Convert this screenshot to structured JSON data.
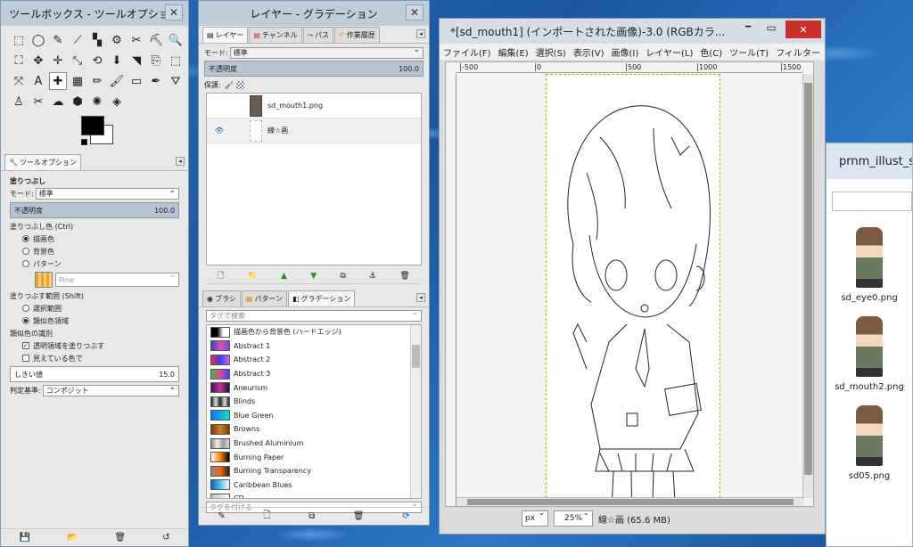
{
  "toolbox": {
    "title": "ツールボックス - ツールオプション",
    "close": "✕",
    "tools": [
      "⬚",
      "◯",
      "✎",
      "⟋",
      "▚",
      "⚙",
      "✂",
      "⛏",
      "🔍",
      "⛶",
      "✥",
      "✛",
      "⤡",
      "⟲",
      "⬇",
      "◥",
      "⎘",
      "⬚",
      "⤧",
      "A",
      "✚",
      "▦",
      "✏",
      "🖌",
      "▭",
      "✒",
      "⛛",
      "♙",
      "✂",
      "☁",
      "⬢",
      "✺",
      "◈"
    ],
    "options_tab": "ツールオプション",
    "tool_name": "塗りつぶし",
    "mode_label": "モード:",
    "mode_value": "標準",
    "opacity_label": "不透明度",
    "opacity_value": "100.0",
    "fill_type_label": "塗りつぶし色 (Ctrl)",
    "fill_fg": "描画色",
    "fill_bg": "背景色",
    "fill_pattern": "パターン",
    "pattern_name": "Pine",
    "affected_label": "塗りつぶす範囲 (Shift)",
    "affected_selection": "選択範囲",
    "affected_similar": "類似色領域",
    "similar_label": "類似色の識別",
    "transparent_fill": "透明領域を塗りつぶす",
    "sample_merged": "見えている色で",
    "threshold_label": "しきい値",
    "threshold_value": "15.0",
    "criterion_label": "判定基準:",
    "criterion_value": "コンポジット"
  },
  "layers": {
    "title": "レイヤー - グラデーション",
    "close": "✕",
    "tabs": [
      "レイヤー",
      "チャンネル",
      "パス",
      "作業履歴"
    ],
    "mode_label": "モード:",
    "mode_value": "標準",
    "opacity_label": "不透明度",
    "opacity_value": "100.0",
    "lock_label": "保護:",
    "items": [
      {
        "name": "sd_mouth1.png",
        "visible": false
      },
      {
        "name": "線☆画",
        "visible": true
      }
    ],
    "bottom_tabs": [
      "ブラシ",
      "パターン",
      "グラデーション"
    ],
    "search_placeholder": "タグで検索",
    "tag_placeholder": "タグを付ける",
    "gradients": [
      {
        "name": "描画色から背景色 (ハードエッジ)",
        "colors": [
          "#000000",
          "#000000",
          "#ffffff",
          "#ffffff"
        ]
      },
      {
        "name": "Abstract 1",
        "colors": [
          "#2a3fd8",
          "#e84fa8",
          "#7048e0"
        ]
      },
      {
        "name": "Abstract 2",
        "colors": [
          "#ff2a2a",
          "#3040ff",
          "#e060e0"
        ]
      },
      {
        "name": "Abstract 3",
        "colors": [
          "#30c030",
          "#f040a0",
          "#3050f0"
        ]
      },
      {
        "name": "Aneurism",
        "colors": [
          "#401060",
          "#d03090",
          "#101050"
        ]
      },
      {
        "name": "Blinds",
        "colors": [
          "#222222",
          "#dddddd",
          "#222222",
          "#dddddd",
          "#222222"
        ]
      },
      {
        "name": "Blue Green",
        "colors": [
          "#1070ff",
          "#10e0c0"
        ]
      },
      {
        "name": "Browns",
        "colors": [
          "#7a3a08",
          "#d08030",
          "#7a3a08"
        ]
      },
      {
        "name": "Brushed Aluminium",
        "colors": [
          "#888888",
          "#eeeeee",
          "#999999",
          "#dddddd"
        ]
      },
      {
        "name": "Burning Paper",
        "colors": [
          "#ffffff",
          "#ff8800",
          "#000000"
        ]
      },
      {
        "name": "Burning Transparency",
        "colors": [
          "#888888",
          "#ff6600",
          "#222222"
        ]
      },
      {
        "name": "Caribbean Blues",
        "colors": [
          "#1060c0",
          "#50c0f0",
          "#ffffff"
        ]
      },
      {
        "name": "CD",
        "colors": [
          "#c0c0c0",
          "#ffffff"
        ]
      }
    ]
  },
  "image_window": {
    "title": "*[sd_mouth1] (インポートされた画像)-3.0 (RGBカラ...",
    "menu": [
      "ファイル(F)",
      "編集(E)",
      "選択(S)",
      "表示(V)",
      "画像(I)",
      "レイヤー(L)",
      "色(C)",
      "ツール(T)",
      "フィルター"
    ],
    "ruler_marks": [
      "-500",
      "0",
      "500",
      "1000",
      "1500"
    ],
    "unit": "px",
    "zoom": "25%",
    "status": "線☆画 (65.6 MB)",
    "min_btn": "━",
    "max_btn": "▭",
    "close_btn": "✕"
  },
  "explorer": {
    "title": "prnm_illust_s",
    "files": [
      "sd_eye0.png",
      "sd_mouth2.png",
      "sd05.png"
    ]
  }
}
